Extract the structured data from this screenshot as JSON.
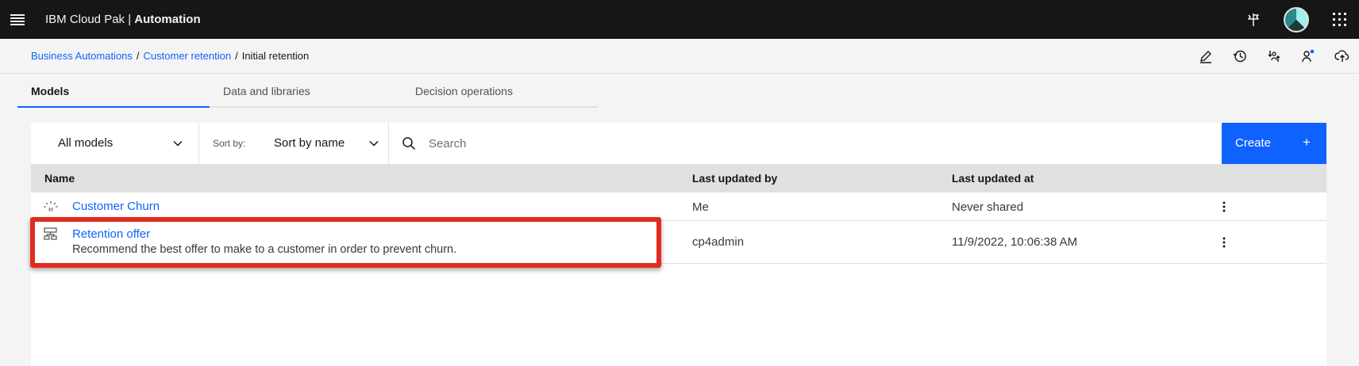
{
  "header": {
    "brand_prefix": "IBM Cloud Pak | ",
    "brand_product": "Automation",
    "icons": [
      "menu-icon",
      "signpost-icon",
      "user-avatar",
      "app-switcher-icon"
    ]
  },
  "breadcrumb": {
    "items": [
      {
        "label": "Business Automations",
        "link": true
      },
      {
        "label": "Customer retention",
        "link": true
      },
      {
        "label": "Initial retention",
        "link": false
      }
    ],
    "separator": "/",
    "actions": [
      "edit-icon",
      "history-icon",
      "compare-icon",
      "share-icon",
      "deploy-icon"
    ]
  },
  "tabs": [
    {
      "label": "Models",
      "active": true
    },
    {
      "label": "Data and libraries",
      "active": false
    },
    {
      "label": "Decision operations",
      "active": false
    }
  ],
  "toolbar": {
    "filter_value": "All models",
    "sort_prefix": "Sort by:",
    "sort_value": "Sort by name",
    "search_placeholder": "Search",
    "create_label": "Create",
    "create_icon": "+"
  },
  "table": {
    "headers": {
      "name": "Name",
      "updated_by": "Last updated by",
      "updated_at": "Last updated at"
    },
    "rows": [
      {
        "icon": "decision-model-icon",
        "name": "Customer Churn",
        "description": "",
        "updated_by": "Me",
        "updated_at": "Never shared"
      },
      {
        "icon": "decision-service-icon",
        "name": "Retention offer",
        "description": "Recommend the best offer to make to a customer in order to prevent churn.",
        "updated_by": "cp4admin",
        "updated_at": "11/9/2022, 10:06:38 AM"
      }
    ]
  },
  "colors": {
    "accent": "#0f62fe",
    "header_bg": "#161616",
    "highlight": "#e02b20"
  }
}
